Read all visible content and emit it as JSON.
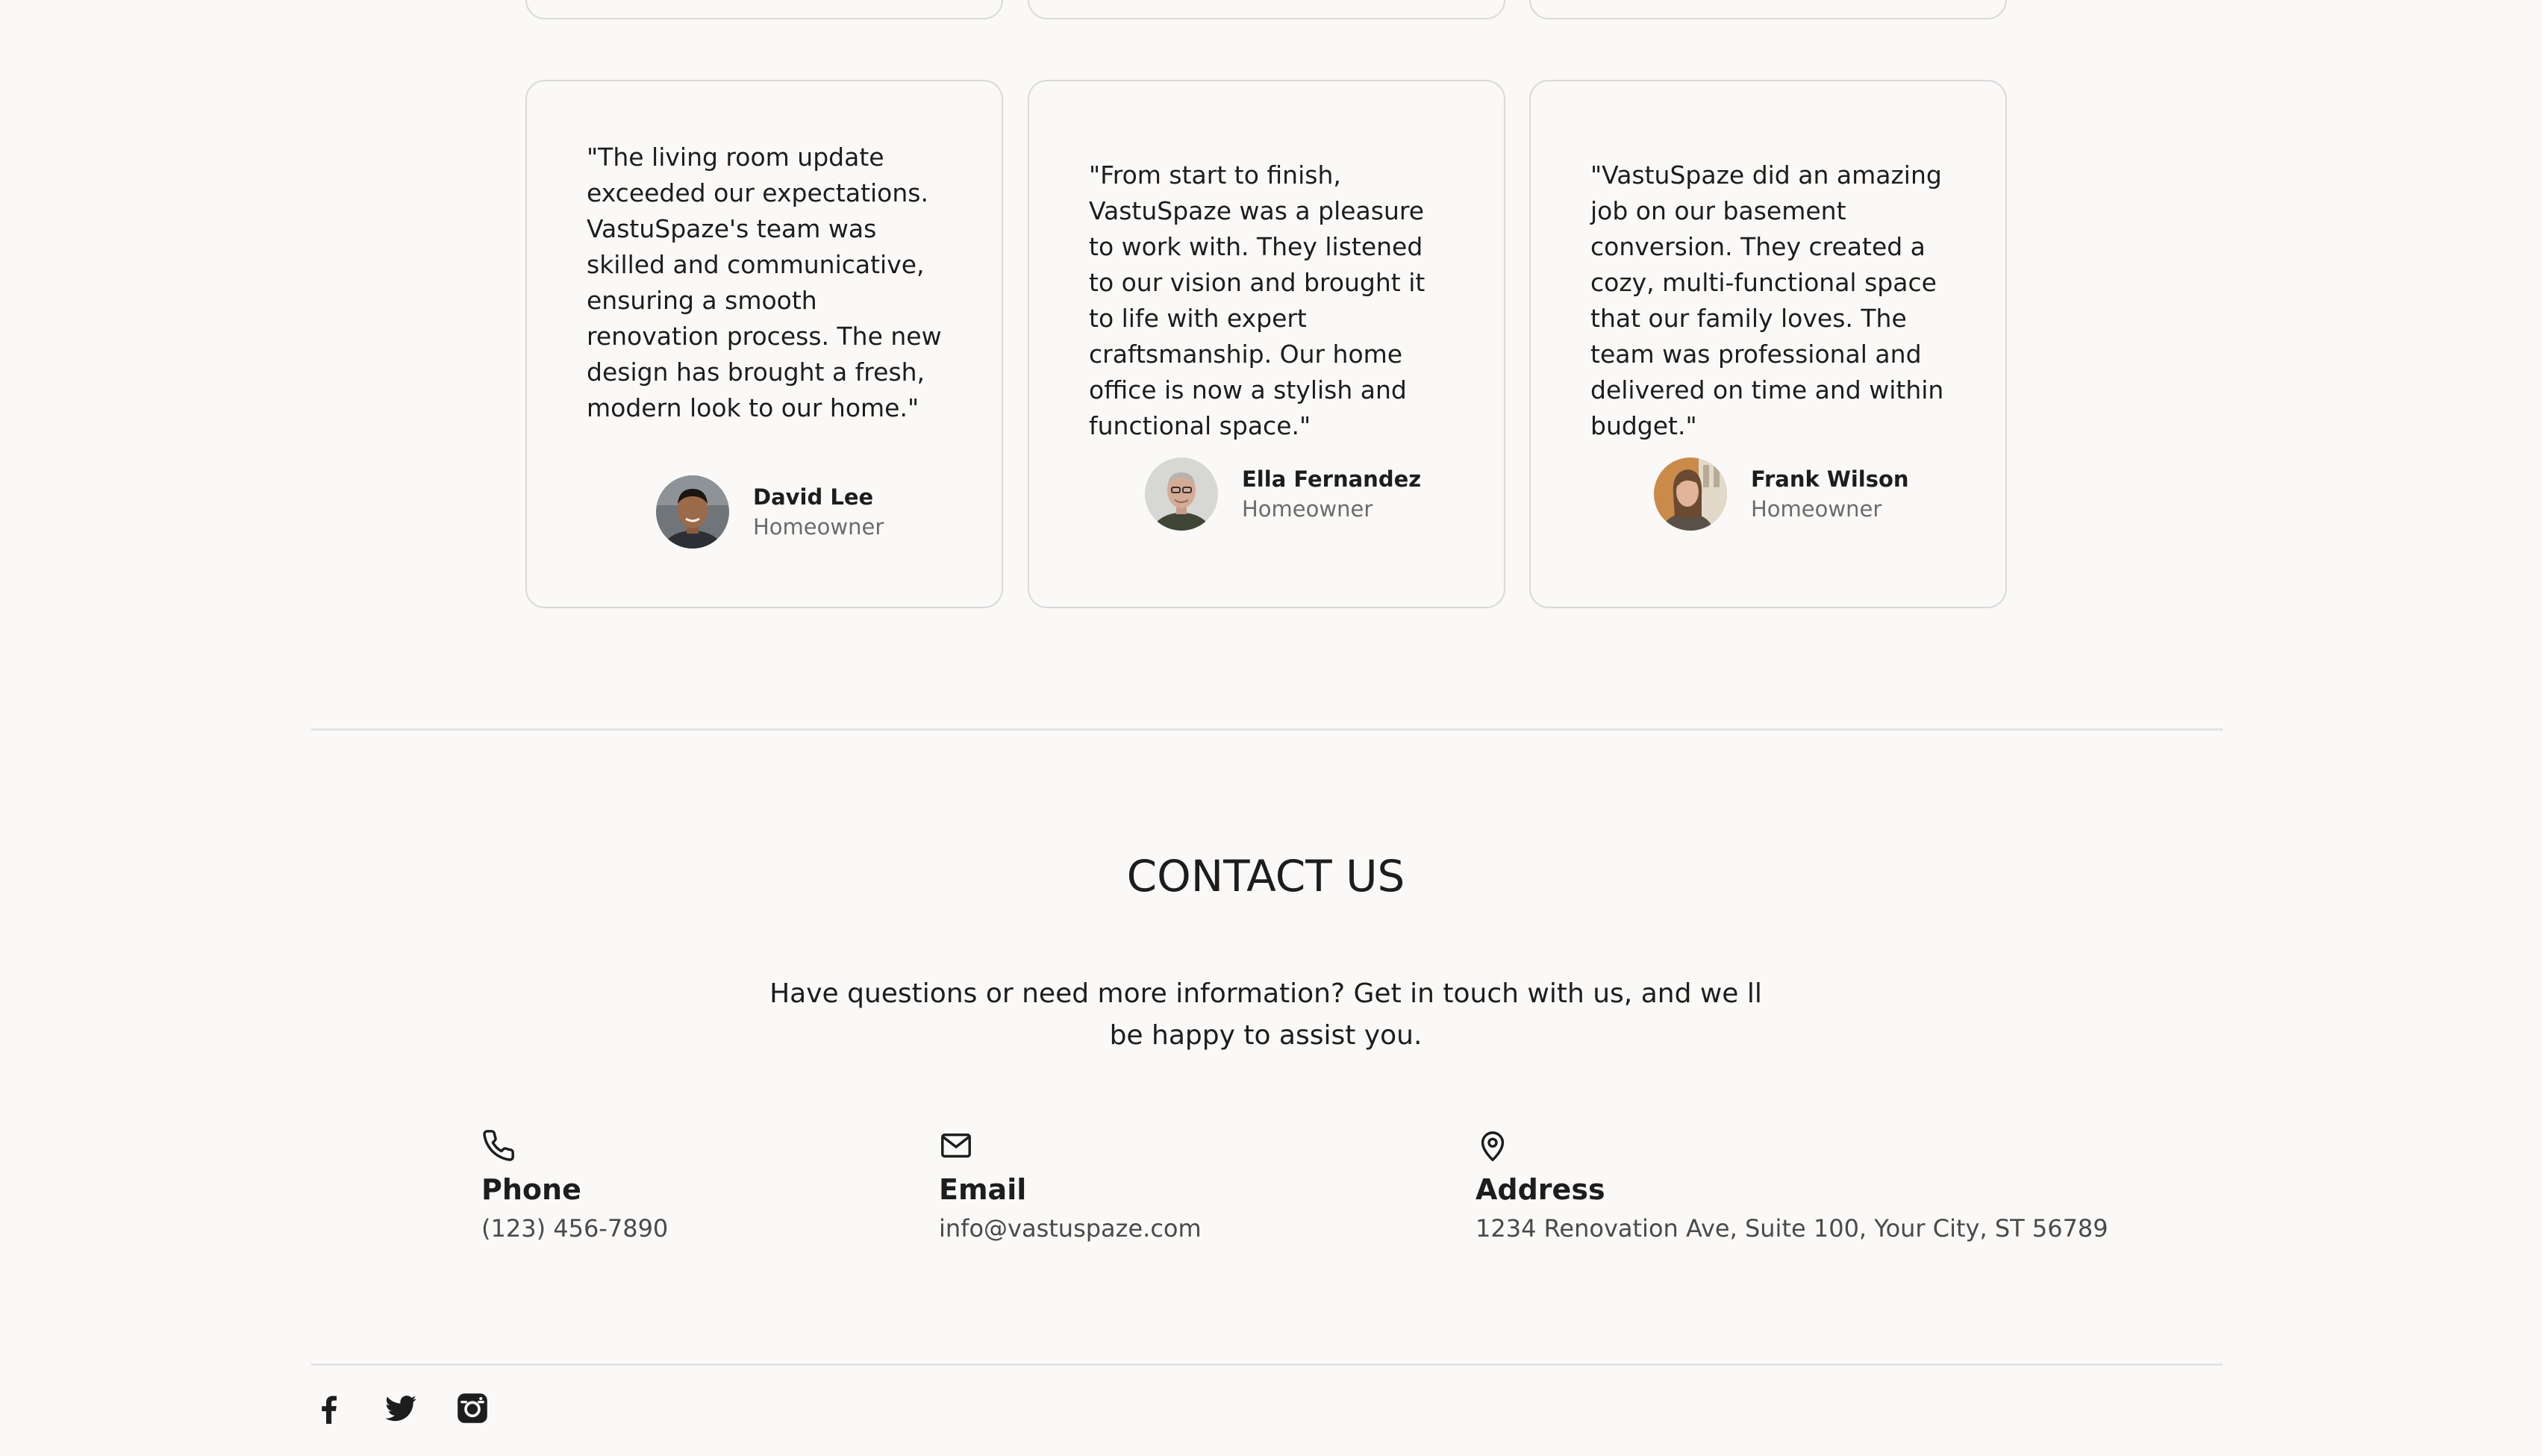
{
  "testimonials": [
    {
      "quote": "\"The living room update exceeded our expectations. VastuSpaze's team was skilled and communicative, ensuring a smooth renovation process. The new design has brought a fresh, modern look to our home.\"",
      "name": "David Lee",
      "role": "Homeowner"
    },
    {
      "quote": "\"From start to finish, VastuSpaze was a pleasure to work with. They listened to our vision and brought it to life with expert craftsmanship. Our home office is now a stylish and functional space.\"",
      "name": "Ella Fernandez",
      "role": "Homeowner"
    },
    {
      "quote": "\"VastuSpaze did an amazing job on our basement conversion. They created a cozy, multi-functional space that our family loves. The team was professional and delivered on time and within budget.\"",
      "name": "Frank Wilson",
      "role": "Homeowner"
    }
  ],
  "contact": {
    "title": "CONTACT US",
    "description": "Have questions or need more information? Get in touch with us, and we ll be happy to assist you.",
    "phone": {
      "icon": "phone-icon",
      "label": "Phone",
      "value": "(123) 456-7890"
    },
    "email": {
      "icon": "mail-icon",
      "label": "Email",
      "value": "info@vastuspaze.com"
    },
    "address": {
      "icon": "map-pin-icon",
      "label": "Address",
      "value": "1234 Renovation Ave, Suite 100, Your City, ST 56789"
    }
  },
  "social": [
    {
      "icon": "facebook-icon"
    },
    {
      "icon": "twitter-icon"
    },
    {
      "icon": "instagram-icon"
    }
  ],
  "colors": {
    "background": "#faf9f7",
    "card_border": "#d9d9d9",
    "text": "#1d1d1d",
    "muted_text": "#6b6b6b",
    "divider": "#e3e3e3"
  }
}
